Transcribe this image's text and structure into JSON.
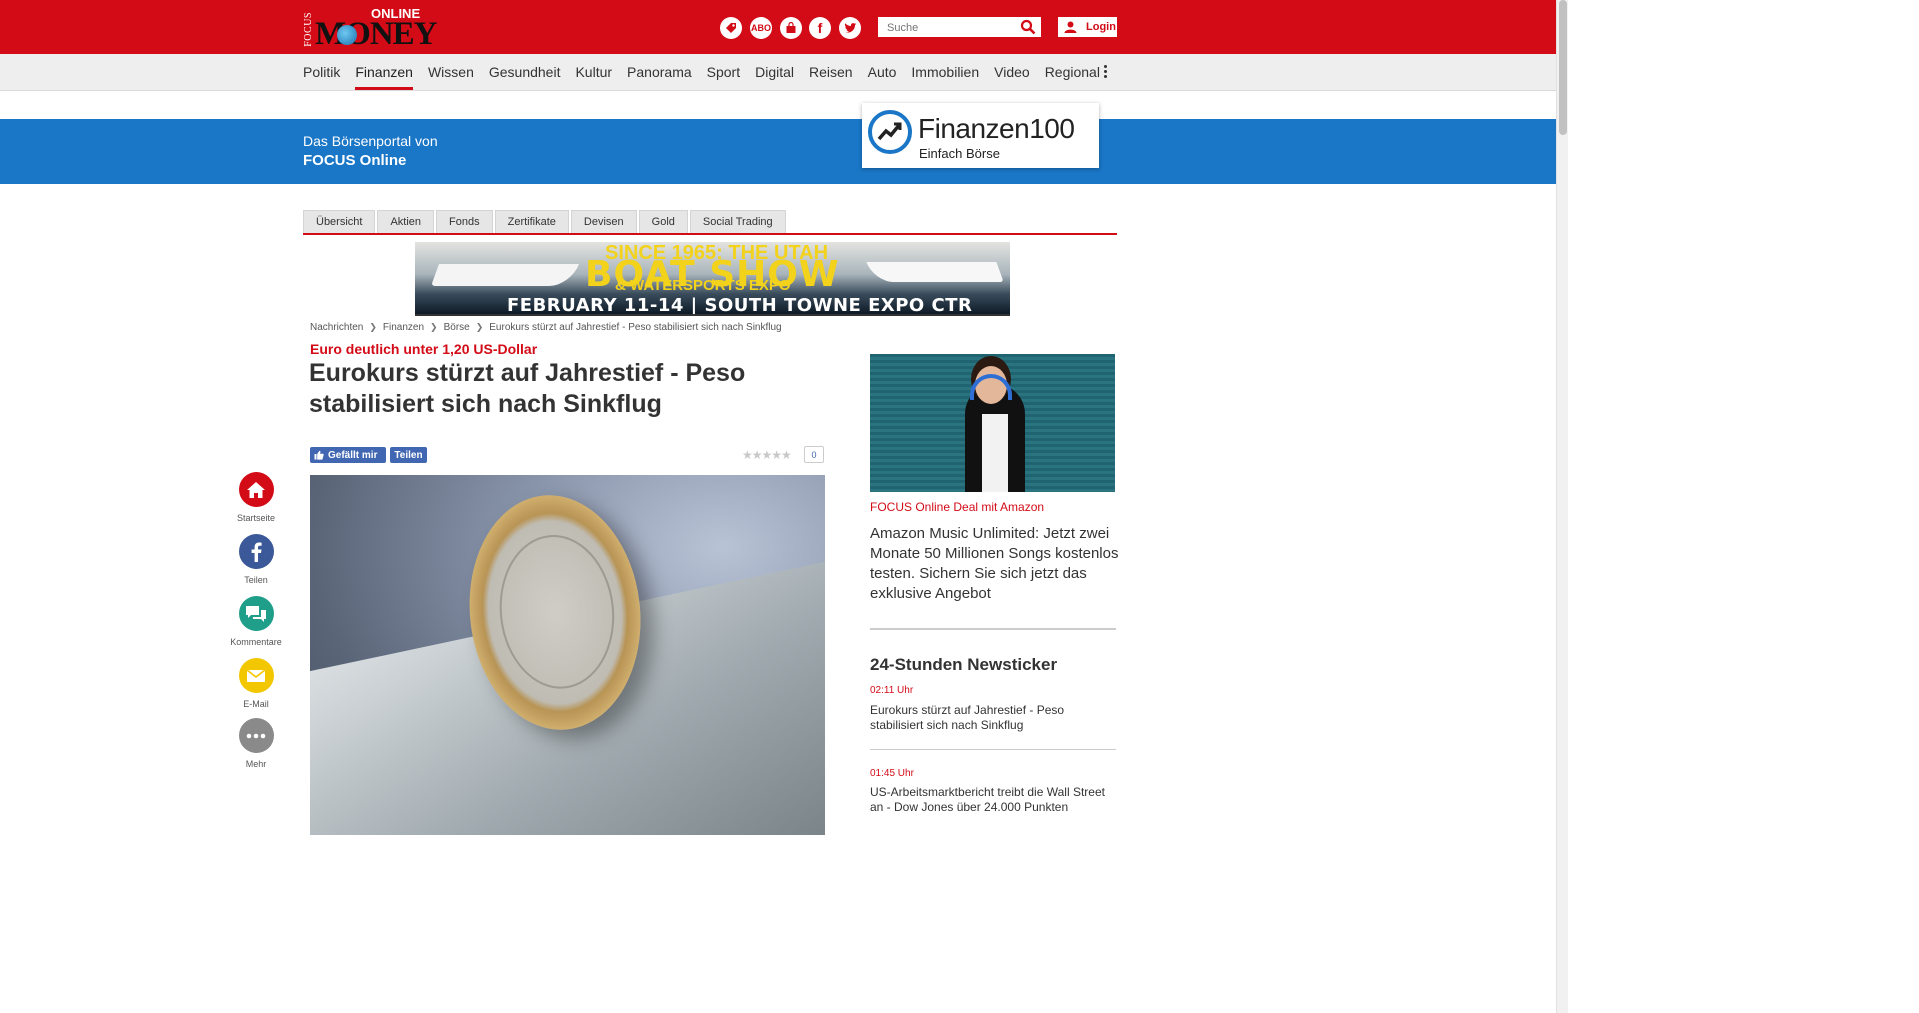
{
  "header": {
    "logo": {
      "focus": "FOCUS",
      "online": "ONLINE",
      "money": "MONEY"
    },
    "icons": [
      {
        "name": "deals-icon",
        "label": ""
      },
      {
        "name": "abo-icon",
        "label": "ABO"
      },
      {
        "name": "shop-bag-icon",
        "label": ""
      },
      {
        "name": "facebook-icon",
        "label": "f"
      },
      {
        "name": "twitter-icon",
        "label": ""
      }
    ],
    "search_placeholder": "Suche",
    "login_label": "Login"
  },
  "nav": {
    "items": [
      "Politik",
      "Finanzen",
      "Wissen",
      "Gesundheit",
      "Kultur",
      "Panorama",
      "Sport",
      "Digital",
      "Reisen",
      "Auto",
      "Immobilien",
      "Video",
      "Regional"
    ],
    "active": "Finanzen"
  },
  "banner": {
    "line1": "Das Börsenportal von",
    "line2": "FOCUS Online",
    "brand_name": "Finanzen",
    "brand_num": "100",
    "brand_tagline": "Einfach Börse"
  },
  "subtabs": [
    "Übersicht",
    "Aktien",
    "Fonds",
    "Zertifikate",
    "Devisen",
    "Gold",
    "Social Trading"
  ],
  "ad": {
    "since": "SINCE 1965: THE UTAH",
    "boat": "BOAT SHOW",
    "expo": "& WATERSPORTS EXPO",
    "date": "FEBRUARY 11-14  |  SOUTH TOWNE EXPO CTR"
  },
  "breadcrumb": [
    "Nachrichten",
    "Finanzen",
    "Börse",
    "Eurokurs stürzt auf Jahrestief - Peso stabilisiert sich nach Sinkflug"
  ],
  "article": {
    "kicker": "Euro deutlich unter 1,20 US-Dollar",
    "headline": "Eurokurs stürzt auf Jahrestief - Peso stabilisiert sich nach Sinkflug",
    "like_label": "Gefällt mir",
    "share_label": "Teilen",
    "stars": "★★★★★",
    "rating_count": "0"
  },
  "social": [
    {
      "label": "Startseite",
      "icon": "home-icon",
      "color": "#d30b17"
    },
    {
      "label": "Teilen",
      "icon": "facebook-icon",
      "color": "#3b5998"
    },
    {
      "label": "Kommentare",
      "icon": "comments-icon",
      "color": "#1f9e8a"
    },
    {
      "label": "E-Mail",
      "icon": "mail-icon",
      "color": "#f2c700"
    },
    {
      "label": "Mehr",
      "icon": "more-icon",
      "color": "#8a8a8a"
    }
  ],
  "sidebar": {
    "promo_source": "FOCUS Online Deal mit Amazon",
    "promo_text": "Amazon Music Unlimited: Jetzt zwei Monate 50 Millionen Songs kostenlos testen. Sichern Sie sich jetzt das exklusive Angebot",
    "ticker_title": "24-Stunden Newsticker",
    "ticker": [
      {
        "time": "02:11 Uhr",
        "text": "Eurokurs stürzt auf Jahrestief - Peso stabilisiert sich nach Sinkflug"
      },
      {
        "time": "01:45 Uhr",
        "text": "US-Arbeitsmarktbericht treibt die Wall Street an - Dow Jones über 24.000 Punkten"
      }
    ]
  },
  "colors": {
    "brand_red": "#d30b17",
    "banner_blue": "#1a76c6",
    "facebook_blue": "#4267b2"
  }
}
